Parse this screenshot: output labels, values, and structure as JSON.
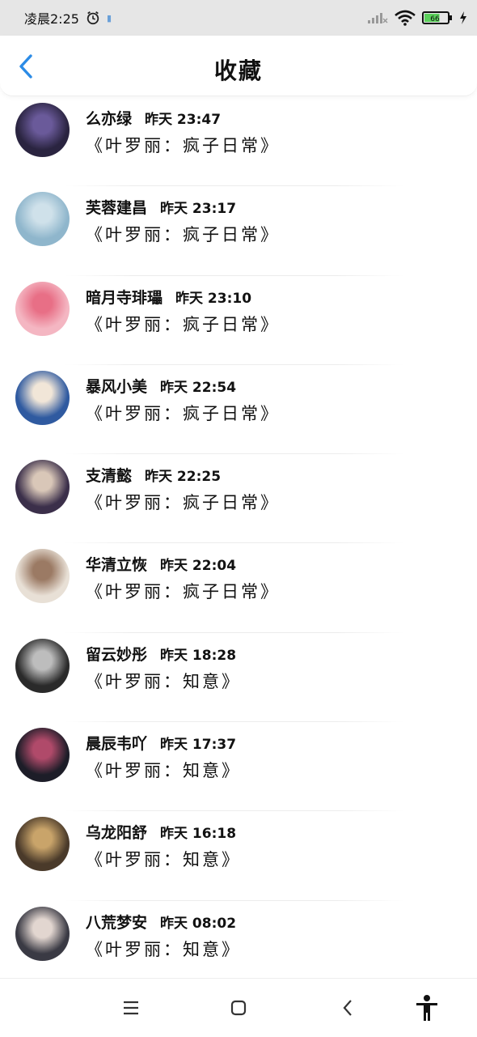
{
  "status_bar": {
    "time": "凌晨2:25",
    "battery_level": "66",
    "icons": [
      "alarm-icon",
      "notification-icon",
      "signal-icon",
      "wifi-icon",
      "battery-icon",
      "charging-icon"
    ]
  },
  "header": {
    "title": "收藏",
    "back_icon": "back-chevron-icon"
  },
  "colors": {
    "accent": "#2b8be6",
    "battery_green": "#5bd15b",
    "status_bar_bg": "#e6e6e6"
  },
  "favorites": [
    {
      "name": "么亦绿",
      "time": "昨天 23:47",
      "title": "《叶罗丽：疯子日常》",
      "avatar_colors": [
        "#2a2440",
        "#6a5a9a"
      ]
    },
    {
      "name": "芙蓉建昌",
      "time": "昨天 23:17",
      "title": "《叶罗丽：疯子日常》",
      "avatar_colors": [
        "#8fb6cc",
        "#cfe1ea"
      ]
    },
    {
      "name": "暗月寺琲瓃",
      "time": "昨天 23:10",
      "title": "《叶罗丽：疯子日常》",
      "avatar_colors": [
        "#f4b6c2",
        "#e86f86"
      ]
    },
    {
      "name": "暴风小美",
      "time": "昨天 22:54",
      "title": "《叶罗丽：疯子日常》",
      "avatar_colors": [
        "#2f5aa0",
        "#f1e6d8"
      ]
    },
    {
      "name": "支清懿",
      "time": "昨天 22:25",
      "title": "《叶罗丽：疯子日常》",
      "avatar_colors": [
        "#3b2f4a",
        "#d9c7b8"
      ]
    },
    {
      "name": "华清立恢",
      "time": "昨天 22:04",
      "title": "《叶罗丽：疯子日常》",
      "avatar_colors": [
        "#e8e0d6",
        "#9b7a64"
      ]
    },
    {
      "name": "留云妙彤",
      "time": "昨天 18:28",
      "title": "《叶罗丽：知意》",
      "avatar_colors": [
        "#2a2a2a",
        "#bdbdbd"
      ]
    },
    {
      "name": "晨辰韦吖",
      "time": "昨天 17:37",
      "title": "《叶罗丽：知意》",
      "avatar_colors": [
        "#1d1d28",
        "#b04a6a"
      ]
    },
    {
      "name": "乌龙阳舒",
      "time": "昨天 16:18",
      "title": "《叶罗丽：知意》",
      "avatar_colors": [
        "#4a3a2a",
        "#c9a46a"
      ]
    },
    {
      "name": "八荒梦安",
      "time": "昨天 08:02",
      "title": "《叶罗丽：知意》",
      "avatar_colors": [
        "#3a3a44",
        "#e2d6d0"
      ]
    }
  ],
  "nav_bar": {
    "icons": [
      "menu-icon",
      "home-icon",
      "back-icon",
      "accessibility-icon"
    ]
  }
}
